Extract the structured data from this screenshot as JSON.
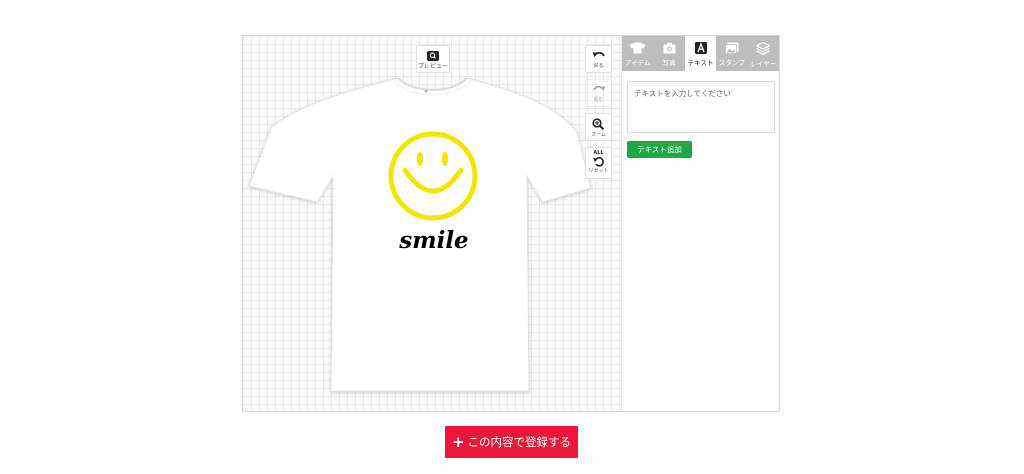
{
  "canvas": {
    "preview_label": "プレビュー",
    "tools": {
      "undo_label": "戻る",
      "redo_label": "進む",
      "zoom_label": "ズーム",
      "reset_badge": "ALL",
      "reset_label": "リセット"
    },
    "design": {
      "text": "smile",
      "text_color": "#000000",
      "smiley_color": "#f2e600",
      "shirt_color": "#ffffff"
    }
  },
  "panel": {
    "tabs": [
      {
        "label": "アイテム",
        "icon": "tshirt-icon"
      },
      {
        "label": "写真",
        "icon": "camera-icon"
      },
      {
        "label": "テキスト",
        "icon": "text-a-icon",
        "active": true
      },
      {
        "label": "スタンプ",
        "icon": "image-icon"
      },
      {
        "label": "レイヤー",
        "icon": "layers-icon"
      }
    ],
    "text_input": {
      "value": "",
      "placeholder": "テキストを入力してください"
    },
    "add_text_label": "テキスト追加"
  },
  "register_button": {
    "label": "この内容で登録する",
    "color": "#e8173b"
  },
  "colors": {
    "add_button": "#22a64a",
    "tab_bar": "#bdbdbd"
  }
}
